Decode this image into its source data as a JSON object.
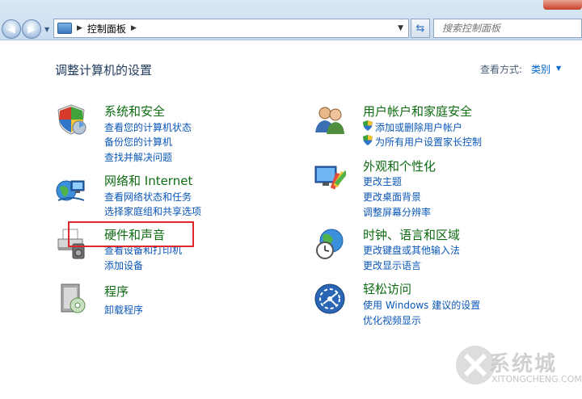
{
  "address_bar": {
    "breadcrumb": "控制面板"
  },
  "search": {
    "placeholder": "搜索控制面板"
  },
  "header": {
    "title": "调整计算机的设置",
    "view_label": "查看方式:",
    "view_value": "类别"
  },
  "categories": [
    {
      "title": "系统和安全",
      "links": [
        "查看您的计算机状态",
        "备份您的计算机",
        "查找并解决问题"
      ],
      "icon": "shield-icon"
    },
    {
      "title": "网络和 Internet",
      "links": [
        "查看网络状态和任务",
        "选择家庭组和共享选项"
      ],
      "icon": "network-globe-icon"
    },
    {
      "title": "硬件和声音",
      "links": [
        "查看设备和打印机",
        "添加设备"
      ],
      "icon": "printer-icon"
    },
    {
      "title": "程序",
      "links": [
        "卸载程序"
      ],
      "icon": "programs-icon"
    },
    {
      "title": "用户帐户和家庭安全",
      "links": [
        "添加或删除用户帐户",
        "为所有用户设置家长控制"
      ],
      "icon": "users-icon"
    },
    {
      "title": "外观和个性化",
      "links": [
        "更改主题",
        "更改桌面背景",
        "调整屏幕分辨率"
      ],
      "icon": "appearance-icon"
    },
    {
      "title": "时钟、语言和区域",
      "links": [
        "更改键盘或其他输入法",
        "更改显示语言"
      ],
      "icon": "clock-globe-icon"
    },
    {
      "title": "轻松访问",
      "links": [
        "使用 Windows 建议的设置",
        "优化视频显示"
      ],
      "icon": "ease-of-access-icon"
    }
  ],
  "watermark": {
    "text": "系统城",
    "sub": "XITONGCHENG.COM"
  },
  "colors": {
    "title_green": "#0e6b11",
    "link_blue": "#0b57b8",
    "highlight_red": "#e02727"
  }
}
